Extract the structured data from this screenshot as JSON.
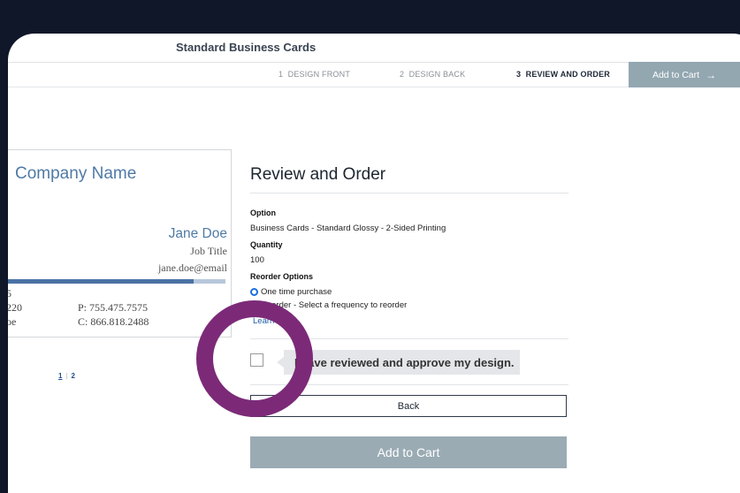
{
  "header": {
    "title": "Standard Business Cards"
  },
  "steps": [
    {
      "num": "1",
      "label": "DESIGN FRONT"
    },
    {
      "num": "2",
      "label": "DESIGN BACK"
    },
    {
      "num": "3",
      "label": "REVIEW AND ORDER"
    }
  ],
  "top_cart": {
    "label": "Add to Cart",
    "arrow": "→"
  },
  "card": {
    "company": "Company Name",
    "name": "Jane Doe",
    "job_title": "Job Title",
    "email": "jane.doe@email",
    "addr1": "5",
    "addr2": "220",
    "addr3": "oe",
    "phone": "P: 755.475.7575",
    "cell": "C: 866.818.2488"
  },
  "pager": {
    "p1": "1",
    "p2": "2"
  },
  "review": {
    "title": "Review and Order",
    "option_label": "Option",
    "option_value": "Business Cards - Standard Glossy - 2-Sided Printing",
    "quantity_label": "Quantity",
    "quantity_value": "100",
    "reorder_label": "Reorder Options",
    "reorder_opt1": "One time purchase",
    "reorder_opt2": "Reorder - Select a frequency to reorder",
    "learn_more": "Learn m",
    "approve_text": "I have reviewed and approve my design.",
    "back_label": "Back",
    "cart_label": "Add to Cart"
  },
  "colors": {
    "accent": "#4f7aa6",
    "ring": "#7c2a78",
    "cart": "#9aabb3"
  }
}
